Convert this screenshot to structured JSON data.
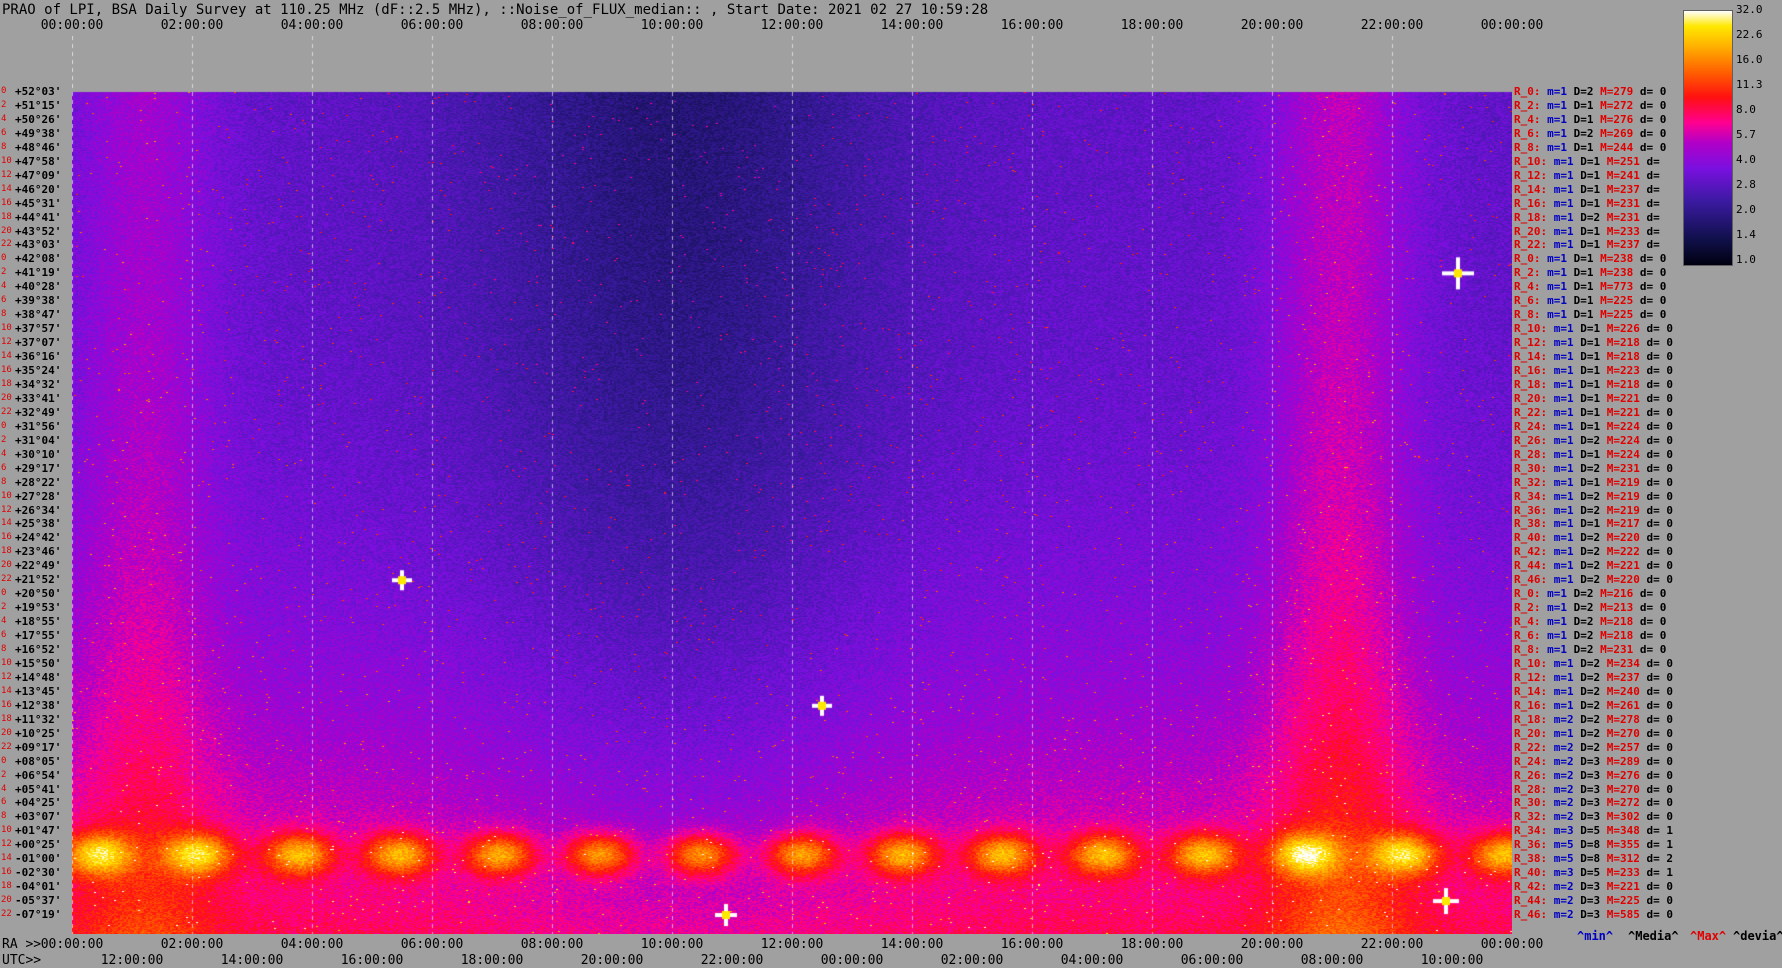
{
  "window": {
    "title": "PRAO of LPI, BSA Daily Survey at 110.25 MHz (dF::2.5 MHz), ::Noise_of_FLUX_median:: , Start Date: 2021 02 27 10:59:28"
  },
  "chart_data": {
    "type": "heatmap",
    "title": "PRAO of LPI, BSA Daily Survey at 110.25 MHz (dF::2.5 MHz), ::Noise_of_FLUX_median:: , Start Date: 2021 02 27 10:59:28",
    "top_axis_ticks": [
      "00:00:00",
      "02:00:00",
      "04:00:00",
      "06:00:00",
      "08:00:00",
      "10:00:00",
      "12:00:00",
      "14:00:00",
      "16:00:00",
      "18:00:00",
      "20:00:00",
      "22:00:00",
      "00:00:00"
    ],
    "ra_axis_prefix": "RA >>",
    "ra_axis_ticks": [
      "00:00:00",
      "02:00:00",
      "04:00:00",
      "06:00:00",
      "08:00:00",
      "10:00:00",
      "12:00:00",
      "14:00:00",
      "16:00:00",
      "18:00:00",
      "20:00:00",
      "22:00:00",
      "00:00:00"
    ],
    "utc_axis_prefix": "UTC>>",
    "utc_axis_ticks": [
      "12:0",
      "0:00",
      "14:0",
      "0:00",
      "16:0",
      "0:00",
      "18:0",
      "0:00",
      "20:0",
      "0:00",
      "22:0",
      "0:00",
      "00:0",
      "0:00",
      "02:0",
      "0:00",
      "04:0",
      "0:00",
      "06:0",
      "0:00",
      "08:0",
      "0:00",
      "10:0",
      "0:00"
    ],
    "utc_axis_labels": [
      "12:00:00",
      "14:00:00",
      "16:00:00",
      "18:00:00",
      "20:00:00",
      "22:00:00",
      "00:00:00",
      "02:00:00",
      "04:00:00",
      "06:00:00",
      "08:00:00",
      "10:00:00"
    ],
    "declinations": [
      "+52°03'",
      "+51°15'",
      "+50°26'",
      "+49°38'",
      "+48°46'",
      "+47°58'",
      "+47°09'",
      "+46°20'",
      "+45°31'",
      "+44°41'",
      "+43°52'",
      "+43°03'",
      "+42°08'",
      "+41°19'",
      "+40°28'",
      "+39°38'",
      "+38°47'",
      "+37°57'",
      "+37°07'",
      "+36°16'",
      "+35°24'",
      "+34°32'",
      "+33°41'",
      "+32°49'",
      "+31°56'",
      "+31°04'",
      "+30°10'",
      "+29°17'",
      "+28°22'",
      "+27°28'",
      "+26°34'",
      "+25°38'",
      "+24°42'",
      "+23°46'",
      "+22°49'",
      "+21°52'",
      "+20°50'",
      "+19°53'",
      "+18°55'",
      "+17°55'",
      "+16°52'",
      "+15°50'",
      "+14°48'",
      "+13°45'",
      "+12°38'",
      "+11°32'",
      "+10°25'",
      "+09°17'",
      "+08°05'",
      "+06°54'",
      "+05°41'",
      "+04°25'",
      "+03°07'",
      "+01°47'",
      "+00°25'",
      "-01°00'",
      "-02°30'",
      "-04°01'",
      "-05°37'",
      "-07°19'"
    ],
    "row_stats": [
      {
        "name": "R_0:",
        "m": "m=1",
        "D": "D=2",
        "M": "M=279",
        "d": "d= 0"
      },
      {
        "name": "R_2:",
        "m": "m=1",
        "D": "D=1",
        "M": "M=272",
        "d": "d= 0"
      },
      {
        "name": "R_4:",
        "m": "m=1",
        "D": "D=1",
        "M": "M=276",
        "d": "d= 0"
      },
      {
        "name": "R_6:",
        "m": "m=1",
        "D": "D=2",
        "M": "M=269",
        "d": "d= 0"
      },
      {
        "name": "R_8:",
        "m": "m=1",
        "D": "D=1",
        "M": "M=244",
        "d": "d= 0"
      },
      {
        "name": "R_10:",
        "m": "m=1",
        "D": "D=1",
        "M": "M=251",
        "d": "d="
      },
      {
        "name": "R_12:",
        "m": "m=1",
        "D": "D=1",
        "M": "M=241",
        "d": "d="
      },
      {
        "name": "R_14:",
        "m": "m=1",
        "D": "D=1",
        "M": "M=237",
        "d": "d="
      },
      {
        "name": "R_16:",
        "m": "m=1",
        "D": "D=1",
        "M": "M=231",
        "d": "d="
      },
      {
        "name": "R_18:",
        "m": "m=1",
        "D": "D=2",
        "M": "M=231",
        "d": "d="
      },
      {
        "name": "R_20:",
        "m": "m=1",
        "D": "D=1",
        "M": "M=233",
        "d": "d="
      },
      {
        "name": "R_22:",
        "m": "m=1",
        "D": "D=1",
        "M": "M=237",
        "d": "d="
      },
      {
        "name": "R_0:",
        "m": "m=1",
        "D": "D=1",
        "M": "M=238",
        "d": "d= 0"
      },
      {
        "name": "R_2:",
        "m": "m=1",
        "D": "D=1",
        "M": "M=238",
        "d": "d= 0"
      },
      {
        "name": "R_4:",
        "m": "m=1",
        "D": "D=1",
        "M": "M=773",
        "d": "d= 0"
      },
      {
        "name": "R_6:",
        "m": "m=1",
        "D": "D=1",
        "M": "M=225",
        "d": "d= 0"
      },
      {
        "name": "R_8:",
        "m": "m=1",
        "D": "D=1",
        "M": "M=225",
        "d": "d= 0"
      },
      {
        "name": "R_10:",
        "m": "m=1",
        "D": "D=1",
        "M": "M=226",
        "d": "d= 0"
      },
      {
        "name": "R_12:",
        "m": "m=1",
        "D": "D=1",
        "M": "M=218",
        "d": "d= 0"
      },
      {
        "name": "R_14:",
        "m": "m=1",
        "D": "D=1",
        "M": "M=218",
        "d": "d= 0"
      },
      {
        "name": "R_16:",
        "m": "m=1",
        "D": "D=1",
        "M": "M=223",
        "d": "d= 0"
      },
      {
        "name": "R_18:",
        "m": "m=1",
        "D": "D=1",
        "M": "M=218",
        "d": "d= 0"
      },
      {
        "name": "R_20:",
        "m": "m=1",
        "D": "D=1",
        "M": "M=221",
        "d": "d= 0"
      },
      {
        "name": "R_22:",
        "m": "m=1",
        "D": "D=1",
        "M": "M=221",
        "d": "d= 0"
      },
      {
        "name": "R_24:",
        "m": "m=1",
        "D": "D=1",
        "M": "M=224",
        "d": "d= 0"
      },
      {
        "name": "R_26:",
        "m": "m=1",
        "D": "D=2",
        "M": "M=224",
        "d": "d= 0"
      },
      {
        "name": "R_28:",
        "m": "m=1",
        "D": "D=1",
        "M": "M=224",
        "d": "d= 0"
      },
      {
        "name": "R_30:",
        "m": "m=1",
        "D": "D=2",
        "M": "M=231",
        "d": "d= 0"
      },
      {
        "name": "R_32:",
        "m": "m=1",
        "D": "D=1",
        "M": "M=219",
        "d": "d= 0"
      },
      {
        "name": "R_34:",
        "m": "m=1",
        "D": "D=2",
        "M": "M=219",
        "d": "d= 0"
      },
      {
        "name": "R_36:",
        "m": "m=1",
        "D": "D=2",
        "M": "M=219",
        "d": "d= 0"
      },
      {
        "name": "R_38:",
        "m": "m=1",
        "D": "D=1",
        "M": "M=217",
        "d": "d= 0"
      },
      {
        "name": "R_40:",
        "m": "m=1",
        "D": "D=2",
        "M": "M=220",
        "d": "d= 0"
      },
      {
        "name": "R_42:",
        "m": "m=1",
        "D": "D=2",
        "M": "M=222",
        "d": "d= 0"
      },
      {
        "name": "R_44:",
        "m": "m=1",
        "D": "D=2",
        "M": "M=221",
        "d": "d= 0"
      },
      {
        "name": "R_46:",
        "m": "m=1",
        "D": "D=2",
        "M": "M=220",
        "d": "d= 0"
      },
      {
        "name": "R_0:",
        "m": "m=1",
        "D": "D=2",
        "M": "M=216",
        "d": "d= 0"
      },
      {
        "name": "R_2:",
        "m": "m=1",
        "D": "D=2",
        "M": "M=213",
        "d": "d= 0"
      },
      {
        "name": "R_4:",
        "m": "m=1",
        "D": "D=2",
        "M": "M=218",
        "d": "d= 0"
      },
      {
        "name": "R_6:",
        "m": "m=1",
        "D": "D=2",
        "M": "M=218",
        "d": "d= 0"
      },
      {
        "name": "R_8:",
        "m": "m=1",
        "D": "D=2",
        "M": "M=231",
        "d": "d= 0"
      },
      {
        "name": "R_10:",
        "m": "m=1",
        "D": "D=2",
        "M": "M=234",
        "d": "d= 0"
      },
      {
        "name": "R_12:",
        "m": "m=1",
        "D": "D=2",
        "M": "M=237",
        "d": "d= 0"
      },
      {
        "name": "R_14:",
        "m": "m=1",
        "D": "D=2",
        "M": "M=240",
        "d": "d= 0"
      },
      {
        "name": "R_16:",
        "m": "m=1",
        "D": "D=2",
        "M": "M=261",
        "d": "d= 0"
      },
      {
        "name": "R_18:",
        "m": "m=2",
        "D": "D=2",
        "M": "M=278",
        "d": "d= 0"
      },
      {
        "name": "R_20:",
        "m": "m=1",
        "D": "D=2",
        "M": "M=270",
        "d": "d= 0"
      },
      {
        "name": "R_22:",
        "m": "m=2",
        "D": "D=2",
        "M": "M=257",
        "d": "d= 0"
      },
      {
        "name": "R_24:",
        "m": "m=2",
        "D": "D=3",
        "M": "M=289",
        "d": "d= 0"
      },
      {
        "name": "R_26:",
        "m": "m=2",
        "D": "D=3",
        "M": "M=276",
        "d": "d= 0"
      },
      {
        "name": "R_28:",
        "m": "m=2",
        "D": "D=3",
        "M": "M=270",
        "d": "d= 0"
      },
      {
        "name": "R_30:",
        "m": "m=2",
        "D": "D=3",
        "M": "M=272",
        "d": "d= 0"
      },
      {
        "name": "R_32:",
        "m": "m=2",
        "D": "D=3",
        "M": "M=302",
        "d": "d= 0"
      },
      {
        "name": "R_34:",
        "m": "m=3",
        "D": "D=5",
        "M": "M=348",
        "d": "d= 1"
      },
      {
        "name": "R_36:",
        "m": "m=5",
        "D": "D=8",
        "M": "M=355",
        "d": "d= 1"
      },
      {
        "name": "R_38:",
        "m": "m=5",
        "D": "D=8",
        "M": "M=312",
        "d": "d= 2"
      },
      {
        "name": "R_40:",
        "m": "m=3",
        "D": "D=5",
        "M": "M=233",
        "d": "d= 1"
      },
      {
        "name": "R_42:",
        "m": "m=2",
        "D": "D=3",
        "M": "M=221",
        "d": "d= 0"
      },
      {
        "name": "R_44:",
        "m": "m=2",
        "D": "D=3",
        "M": "M=225",
        "d": "d= 0"
      },
      {
        "name": "R_46:",
        "m": "m=2",
        "D": "D=3",
        "M": "M=585",
        "d": "d= 0"
      }
    ],
    "colorbar_ticks": [
      "32.0",
      "22.6",
      "16.0",
      "11.3",
      "8.0",
      "5.7",
      "4.0",
      "2.8",
      "2.0",
      "1.4",
      "1.0"
    ],
    "legend": {
      "min": "^min^",
      "median": "^Media^",
      "max": "^Max^",
      "devia": "^devia^"
    },
    "colors": {
      "background": "#a0a0a0",
      "row_name": "#e00000",
      "m_color": "#0000c0",
      "max_color": "#e00000"
    },
    "bright_sources": [
      {
        "ra_h": 23.1,
        "dec_row": 13,
        "intensity": 32
      },
      {
        "ra_h": 5.5,
        "dec_row": 35,
        "intensity": 20
      },
      {
        "ra_h": 12.5,
        "dec_row": 44,
        "intensity": 20
      },
      {
        "ra_h": 22.9,
        "dec_row": 58,
        "intensity": 26
      },
      {
        "ra_h": 10.9,
        "dec_row": 59,
        "intensity": 22
      }
    ]
  }
}
